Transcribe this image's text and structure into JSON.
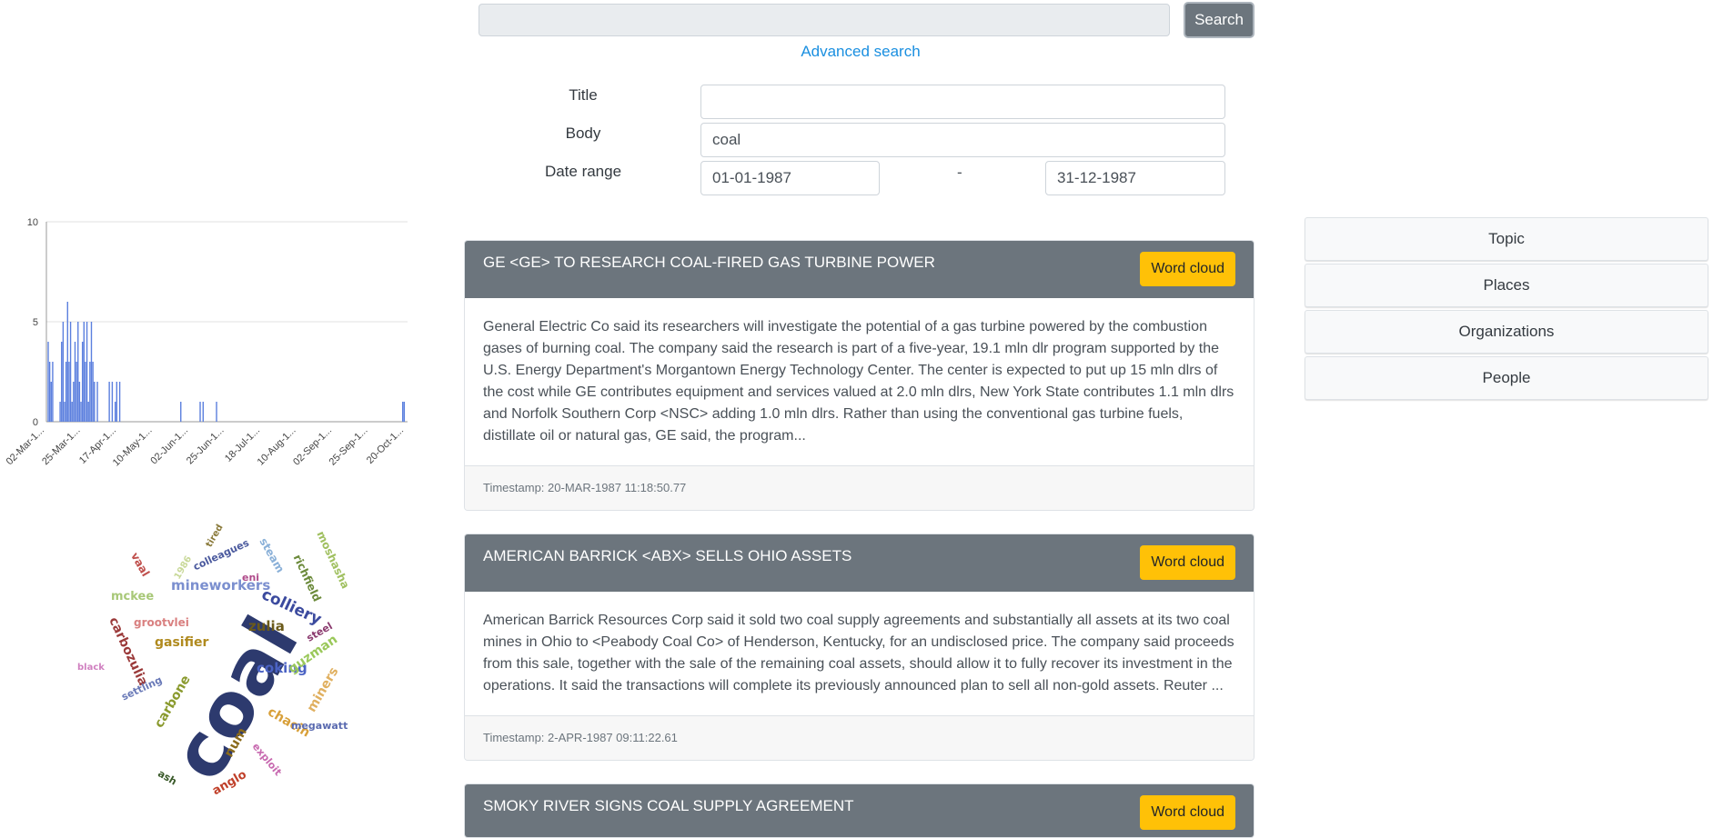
{
  "search": {
    "query_value": "",
    "button_label": "Search",
    "advanced_link": "Advanced search"
  },
  "advanced": {
    "title_label": "Title",
    "title_value": "",
    "body_label": "Body",
    "body_value": "coal",
    "date_label": "Date range",
    "date_from": "01-01-1987",
    "date_separator": "-",
    "date_to": "31-12-1987"
  },
  "chart_data": {
    "type": "bar",
    "title": "",
    "xlabel": "",
    "ylabel": "",
    "ylim": [
      0,
      10
    ],
    "yticks": [
      "0",
      "5",
      "10"
    ],
    "xticks": [
      "02-Mar-1...",
      "25-Mar-1...",
      "17-Apr-1...",
      "10-May-1...",
      "02-Jun-1...",
      "25-Jun-1...",
      "18-Jul-1...",
      "10-Aug-1...",
      "02-Sep-1...",
      "25-Sep-1...",
      "20-Oct-1..."
    ],
    "x_range_days": [
      0,
      240
    ],
    "bars": [
      {
        "day": 0,
        "value": 4
      },
      {
        "day": 1,
        "value": 3
      },
      {
        "day": 2,
        "value": 2
      },
      {
        "day": 3,
        "value": 3
      },
      {
        "day": 8,
        "value": 1
      },
      {
        "day": 9,
        "value": 4
      },
      {
        "day": 10,
        "value": 5
      },
      {
        "day": 11,
        "value": 1
      },
      {
        "day": 12,
        "value": 3
      },
      {
        "day": 13,
        "value": 6
      },
      {
        "day": 14,
        "value": 3
      },
      {
        "day": 15,
        "value": 5
      },
      {
        "day": 16,
        "value": 1
      },
      {
        "day": 17,
        "value": 2
      },
      {
        "day": 18,
        "value": 4
      },
      {
        "day": 19,
        "value": 3
      },
      {
        "day": 20,
        "value": 5
      },
      {
        "day": 21,
        "value": 2
      },
      {
        "day": 22,
        "value": 1
      },
      {
        "day": 23,
        "value": 4
      },
      {
        "day": 24,
        "value": 5
      },
      {
        "day": 25,
        "value": 3
      },
      {
        "day": 26,
        "value": 5
      },
      {
        "day": 27,
        "value": 1
      },
      {
        "day": 28,
        "value": 3
      },
      {
        "day": 29,
        "value": 5
      },
      {
        "day": 30,
        "value": 3
      },
      {
        "day": 31,
        "value": 2
      },
      {
        "day": 33,
        "value": 2
      },
      {
        "day": 41,
        "value": 2
      },
      {
        "day": 43,
        "value": 2
      },
      {
        "day": 45,
        "value": 1
      },
      {
        "day": 46,
        "value": 2
      },
      {
        "day": 48,
        "value": 2
      },
      {
        "day": 89,
        "value": 1
      },
      {
        "day": 102,
        "value": 1
      },
      {
        "day": 104,
        "value": 1
      },
      {
        "day": 113,
        "value": 1
      },
      {
        "day": 238,
        "value": 1
      },
      {
        "day": 239,
        "value": 1
      }
    ],
    "bar_color": "#5b7fde"
  },
  "wordcloud": {
    "words": [
      {
        "text": "coal",
        "color": "#2d3a6e"
      },
      {
        "text": "mineworkers",
        "color": "#7b8fcf"
      },
      {
        "text": "colliery",
        "color": "#3b4a9e"
      },
      {
        "text": "zulia",
        "color": "#6b5a1a"
      },
      {
        "text": "gasifier",
        "color": "#b08a1e"
      },
      {
        "text": "coking",
        "color": "#4b63c4"
      },
      {
        "text": "carbone",
        "color": "#8a9a2e"
      },
      {
        "text": "chacin",
        "color": "#d8a03a"
      },
      {
        "text": "grootvlei",
        "color": "#d98080"
      },
      {
        "text": "mckee",
        "color": "#a8c878"
      },
      {
        "text": "carbozulia",
        "color": "#9b3a3a"
      },
      {
        "text": "vaal",
        "color": "#c0504d"
      },
      {
        "text": "colleagues",
        "color": "#4b5a9e"
      },
      {
        "text": "eni",
        "color": "#b04a8a"
      },
      {
        "text": "steam",
        "color": "#8ab0d8"
      },
      {
        "text": "richfield",
        "color": "#6b8a3a"
      },
      {
        "text": "moshasha",
        "color": "#a0c060"
      },
      {
        "text": "steel",
        "color": "#8a3a6e"
      },
      {
        "text": "guzman",
        "color": "#9ac85a"
      },
      {
        "text": "miners",
        "color": "#e0b060"
      },
      {
        "text": "megawatt",
        "color": "#5a6ab0"
      },
      {
        "text": "num",
        "color": "#8a6a1a"
      },
      {
        "text": "exploit",
        "color": "#c86ab0"
      },
      {
        "text": "anglo",
        "color": "#c0402a"
      },
      {
        "text": "ash",
        "color": "#3a5a2a"
      },
      {
        "text": "settling",
        "color": "#6a7ab8"
      },
      {
        "text": "black",
        "color": "#d080c0"
      },
      {
        "text": "1986",
        "color": "#c8d898"
      },
      {
        "text": "tired",
        "color": "#8a7a3a"
      }
    ]
  },
  "articles": [
    {
      "title": "GE <GE> TO RESEARCH COAL-FIRED GAS TURBINE POWER",
      "button": "Word cloud",
      "body": "General Electric Co said its researchers will investigate the potential of a gas turbine powered by the combustion gases of burning coal. The company said the research is part of a five-year, 19.1 mln dlr program supported by the U.S. Energy Department's Morgantown Energy Technology Center. The center is expected to put up 15 mln dlrs of the cost while GE contributes equipment and services valued at 2.0 mln dlrs, New York State contributes 1.1 mln dlrs and Norfolk Southern Corp <NSC> adding 1.0 mln dlrs. Rather than using the conventional gas turbine fuels, distillate oil or natural gas, GE said, the program...",
      "timestamp": "Timestamp: 20-MAR-1987 11:18:50.77"
    },
    {
      "title": "AMERICAN BARRICK <ABX> SELLS OHIO ASSETS",
      "button": "Word cloud",
      "body": "American Barrick Resources Corp said it sold two coal supply agreements and substantially all assets at its two coal mines in Ohio to <Peabody Coal Co> of Henderson, Kentucky, for an undisclosed price. The company said proceeds from this sale, together with the sale of the remaining coal assets, should allow it to fully recover its investment in the operations. It said the transactions will complete its previously announced plan to sell all non-gold assets. Reuter ...",
      "timestamp": "Timestamp: 2-APR-1987 09:11:22.61"
    },
    {
      "title": "SMOKY RIVER SIGNS COAL SUPPLY AGREEMENT",
      "button": "Word cloud",
      "body": "",
      "timestamp": ""
    }
  ],
  "facets": [
    "Topic",
    "Places",
    "Organizations",
    "People"
  ]
}
